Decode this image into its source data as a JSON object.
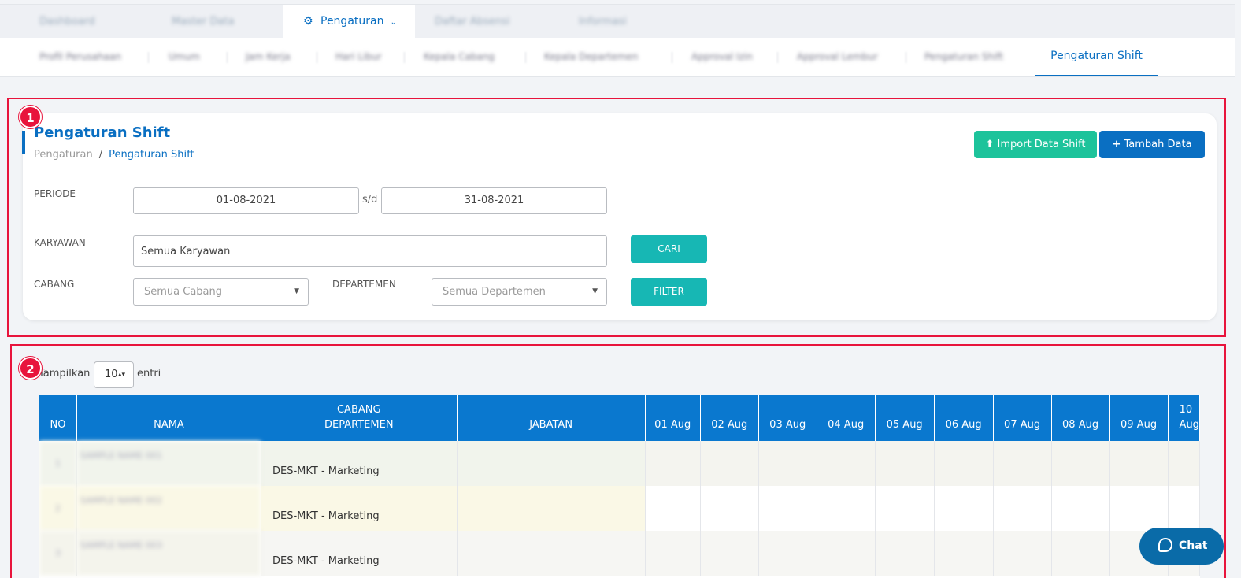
{
  "top_nav": {
    "blurred_items": [
      "Dashboard",
      "Master Data",
      "Pengaturan",
      "Daftar Absensi",
      "Informasi"
    ],
    "active_label": "Pengaturan"
  },
  "sub_nav": {
    "blurred_items": [
      "Profil Perusahaan",
      "Umum",
      "Jam Kerja",
      "Hari Libur",
      "Kepala Cabang",
      "Kepala Departemen",
      "Approval Izin",
      "Approval Lembur",
      "Pengaturan Shift"
    ],
    "active_label": "Pengaturan Shift"
  },
  "badges": {
    "one": "1",
    "two": "2"
  },
  "page": {
    "title": "Pengaturan Shift",
    "breadcrumb": [
      "Pengaturan",
      "Pengaturan Shift"
    ],
    "import_label": "Import Data Shift",
    "tambah_label": "Tambah Data"
  },
  "filters": {
    "periode_label": "PERIODE",
    "start_date": "01-08-2021",
    "range_sep": "s/d",
    "end_date": "31-08-2021",
    "karyawan_label": "KARYAWAN",
    "karyawan_value": "Semua Karyawan",
    "cari_label": "CARI",
    "cabang_label": "CABANG",
    "cabang_value": "Semua Cabang",
    "departemen_label": "DEPARTEMEN",
    "departemen_value": "Semua Departemen",
    "filter_label": "FILTER"
  },
  "table_controls": {
    "show_label": "Tampilkan",
    "page_length": "10",
    "entries_label": "entri"
  },
  "table": {
    "headers": {
      "no": "NO",
      "nama": "NAMA",
      "cabang_line1": "CABANG",
      "cabang_line2": "DEPARTEMEN",
      "jabatan": "JABATAN"
    },
    "dates": [
      "01 Aug",
      "02 Aug",
      "03 Aug",
      "04 Aug",
      "05 Aug",
      "06 Aug",
      "07 Aug",
      "08 Aug",
      "09 Aug",
      "10 Aug"
    ],
    "rows": [
      {
        "no": "1",
        "nama": "SAMPLE NAME 001",
        "departemen": "DES-MKT - Marketing",
        "jabatan": ""
      },
      {
        "no": "2",
        "nama": "SAMPLE NAME 002",
        "departemen": "DES-MKT - Marketing",
        "jabatan": ""
      },
      {
        "no": "3",
        "nama": "SAMPLE NAME 003",
        "departemen": "DES-MKT - Marketing",
        "jabatan": ""
      }
    ]
  },
  "chat": {
    "label": "Chat"
  },
  "colors": {
    "primary": "#0a6fc2",
    "header_bg": "#0a78cf",
    "teal": "#17b7b4",
    "green": "#1dc39b",
    "annotation_red": "#e8143c"
  }
}
